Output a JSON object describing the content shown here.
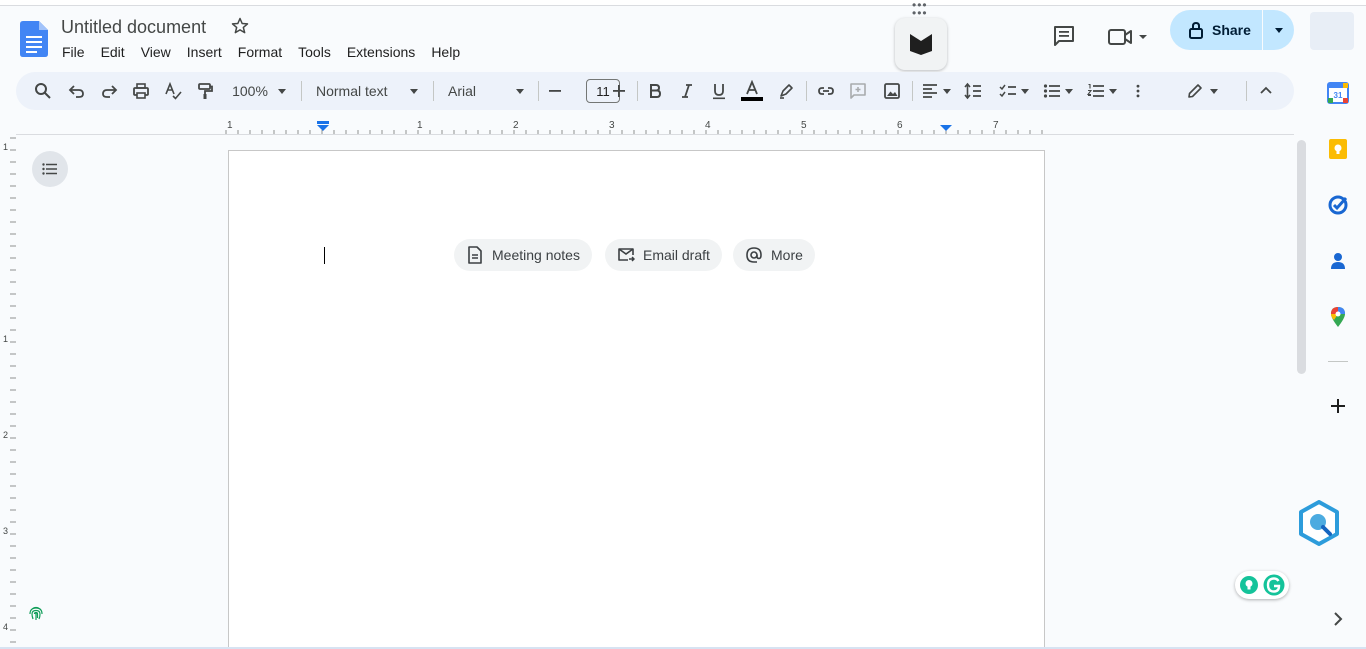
{
  "document": {
    "title": "Untitled document"
  },
  "menu": [
    "File",
    "Edit",
    "View",
    "Insert",
    "Format",
    "Tools",
    "Extensions",
    "Help"
  ],
  "header": {
    "share_label": "Share",
    "share_color": "#c2e7ff"
  },
  "toolbar": {
    "zoom": "100%",
    "style": "Normal text",
    "font": "Arial",
    "font_size": "11"
  },
  "ruler": {
    "labels": [
      "1",
      "1",
      "2",
      "3",
      "4",
      "5",
      "6",
      "7"
    ]
  },
  "vruler": {
    "labels": [
      "1",
      "1",
      "2",
      "3",
      "4"
    ]
  },
  "chips": [
    {
      "label": "Meeting notes",
      "icon": "document-icon"
    },
    {
      "label": "Email draft",
      "icon": "email-icon"
    },
    {
      "label": "More",
      "icon": "at-icon"
    }
  ],
  "side_panel": {
    "apps": [
      "calendar-icon",
      "keep-icon",
      "tasks-icon",
      "contacts-icon",
      "maps-icon"
    ]
  },
  "colors": {
    "accent": "#1a73e8",
    "toolbar_bg": "#edf2fa",
    "page_bg": "#f9fbfd"
  }
}
